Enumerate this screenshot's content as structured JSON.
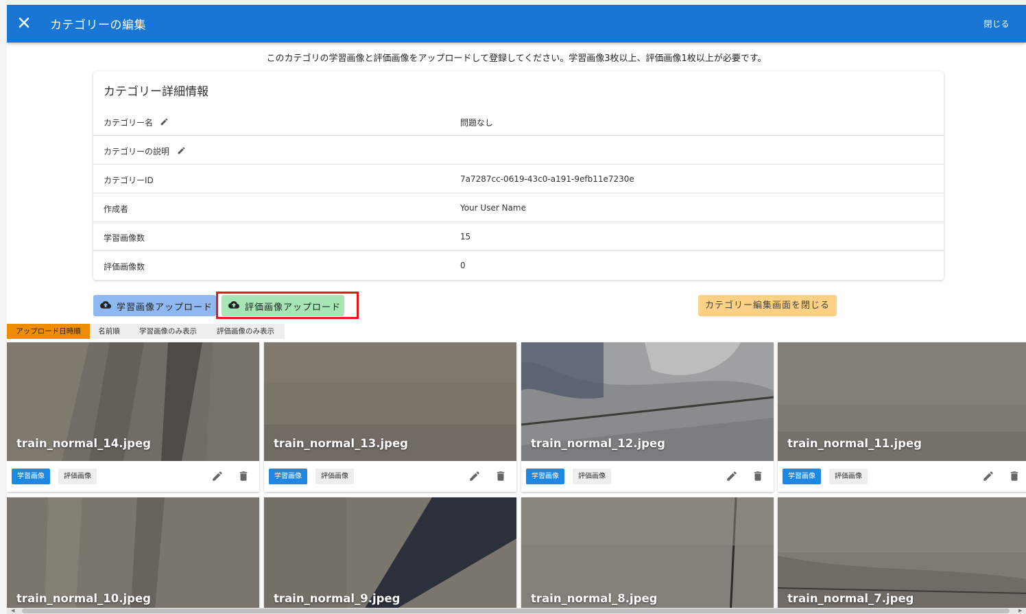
{
  "header": {
    "title": "カテゴリーの編集",
    "close_label": "閉じる"
  },
  "instruction": "このカテゴリの学習画像と評価画像をアップロードして登録してください。学習画像3枚以上、評価画像1枚以上が必要です。",
  "details": {
    "title": "カテゴリー詳細情報",
    "rows": [
      {
        "label": "カテゴリー名",
        "value": "問題なし",
        "editable": true
      },
      {
        "label": "カテゴリーの説明",
        "value": "",
        "editable": true
      },
      {
        "label": "カテゴリーID",
        "value": "7a7287cc-0619-43c0-a191-9efb11e7230e"
      },
      {
        "label": "作成者",
        "value": "Your User Name"
      },
      {
        "label": "学習画像数",
        "value": "15"
      },
      {
        "label": "評価画像数",
        "value": "0"
      }
    ]
  },
  "buttons": {
    "upload_train": "学習画像アップロード",
    "upload_eval": "評価画像アップロード",
    "close_edit": "カテゴリー編集画面を閉じる"
  },
  "sort_tabs": [
    "アップロード日時順",
    "名前順",
    "学習画像のみ表示",
    "評価画像のみ表示"
  ],
  "sort_active": "アップロード日時順",
  "tile_tags": {
    "train": "学習画像",
    "eval": "評価画像"
  },
  "images": [
    {
      "name": "train_normal_14.jpeg",
      "selected": "train"
    },
    {
      "name": "train_normal_13.jpeg",
      "selected": "train"
    },
    {
      "name": "train_normal_12.jpeg",
      "selected": "train"
    },
    {
      "name": "train_normal_11.jpeg",
      "selected": "train"
    },
    {
      "name": "train_normal_10.jpeg"
    },
    {
      "name": "train_normal_9.jpeg"
    },
    {
      "name": "train_normal_8.jpeg"
    },
    {
      "name": "train_normal_7.jpeg"
    }
  ],
  "colors": {
    "appbar": "#1976d2",
    "train_button": "#90b8f0",
    "eval_button": "#a5e6b4",
    "close_edit_button": "#fcd185",
    "active_sort": "#f08c00",
    "train_tag": "#1e88e5",
    "highlight": "#e81616"
  }
}
